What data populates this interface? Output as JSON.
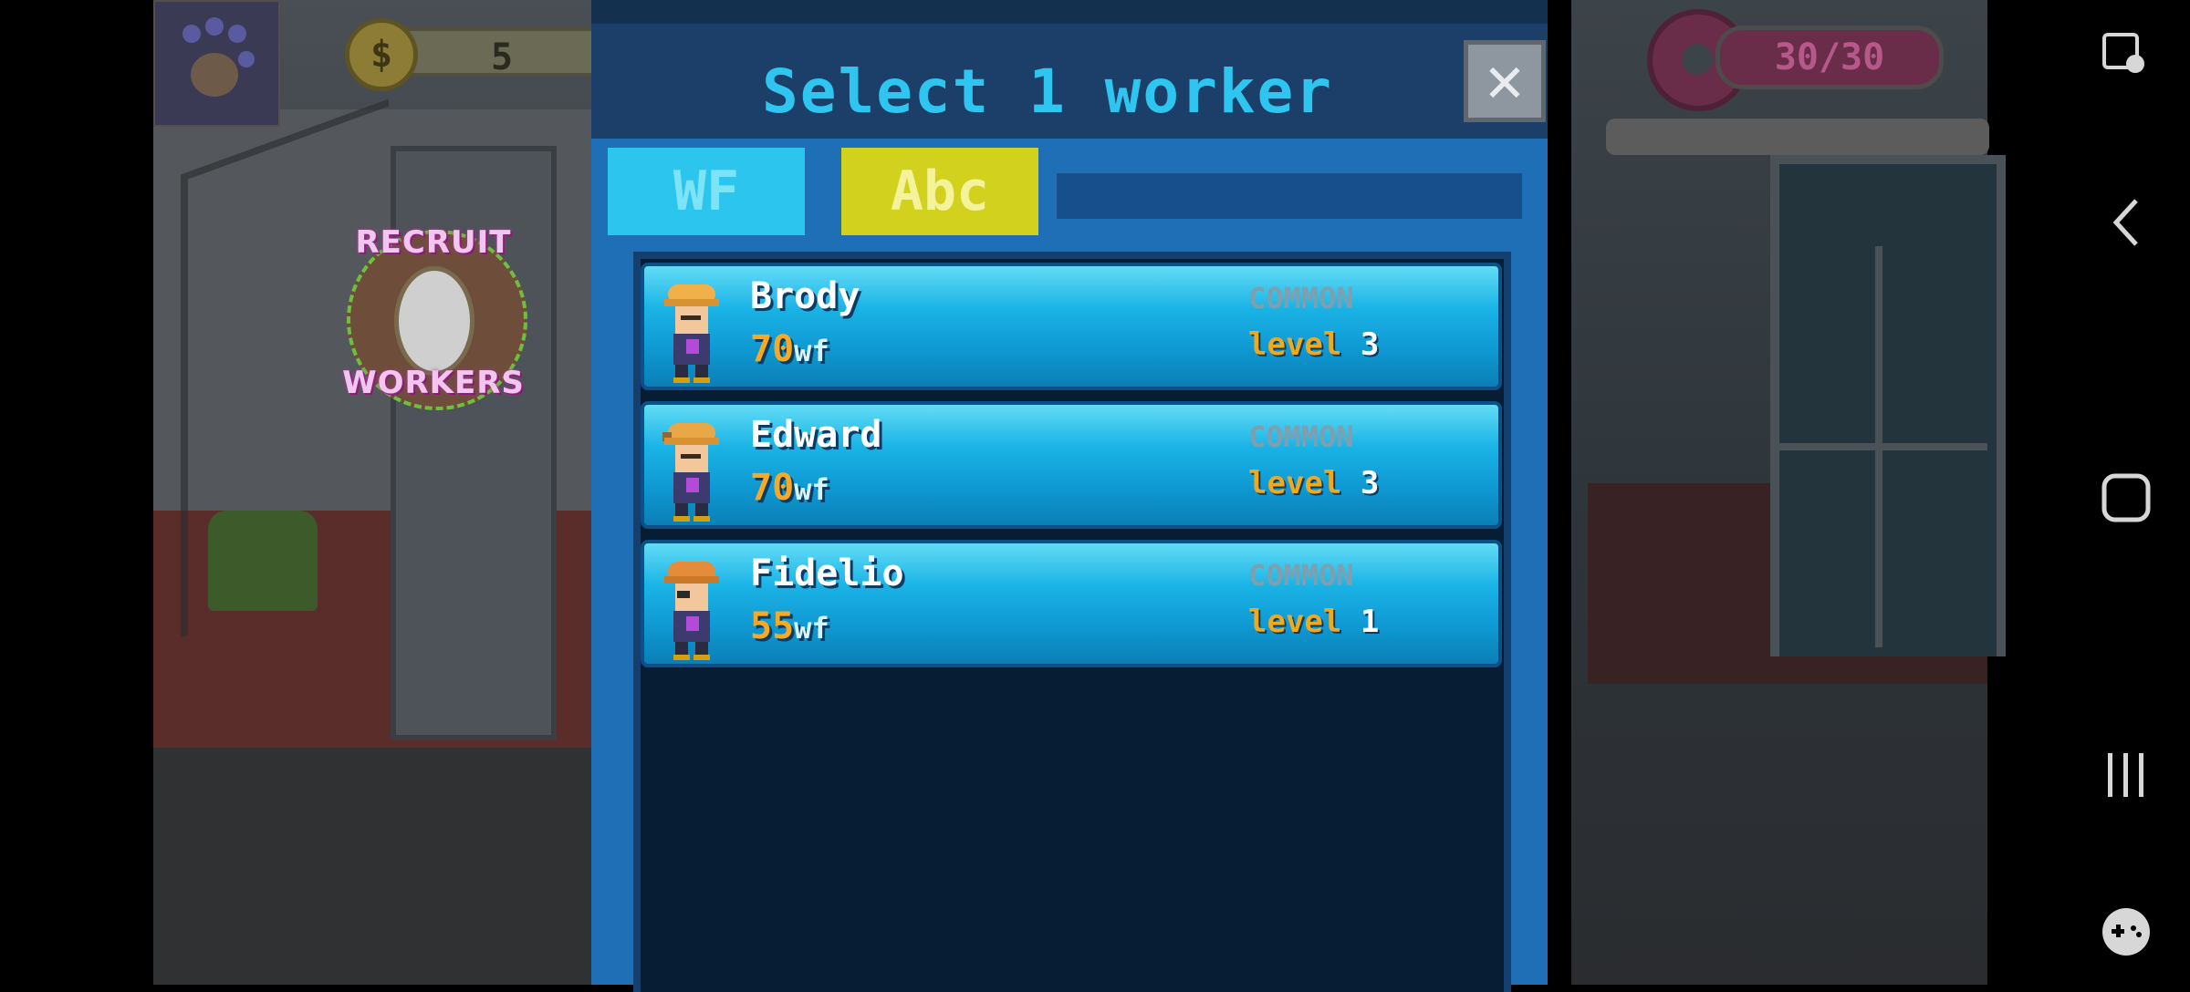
{
  "hud": {
    "coins": "5",
    "donuts": "30/30"
  },
  "recruit": {
    "line1": "RECRUIT",
    "line2": "WORKERS"
  },
  "modal": {
    "title": "Select 1 worker",
    "close_glyph": "✕",
    "tabs": [
      {
        "label": "WF",
        "color": "#2cc5ee"
      },
      {
        "label": "Abc",
        "color": "#d2d11d",
        "selected": true
      }
    ]
  },
  "workers": [
    {
      "name": "Brody",
      "wf": "70",
      "wf_unit": "wf",
      "rarity": "COMMON",
      "level_label": "level",
      "level": "3",
      "hair": "#f0b04a"
    },
    {
      "name": "Edward",
      "wf": "70",
      "wf_unit": "wf",
      "rarity": "COMMON",
      "level_label": "level",
      "level": "3",
      "hair": "#e8a848"
    },
    {
      "name": "Fidelio",
      "wf": "55",
      "wf_unit": "wf",
      "rarity": "COMMON",
      "level_label": "level",
      "level": "1",
      "hair": "#e58c3a"
    }
  ],
  "nav": {
    "icons": [
      "accessibility-icon",
      "back-icon",
      "home-icon",
      "recents-icon",
      "game-tools-icon"
    ]
  },
  "colors": {
    "modal_bg": "#1f6fb7",
    "title": "#2ec6f0",
    "wf_number": "#f7a925",
    "level_label": "#f0a91f"
  }
}
